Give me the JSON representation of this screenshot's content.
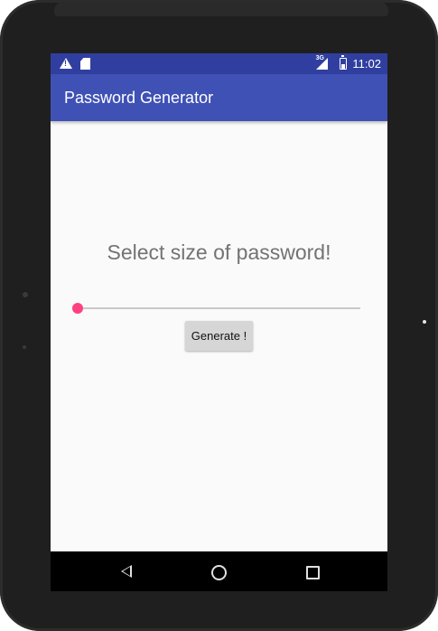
{
  "status_bar": {
    "icons": [
      "warning-icon",
      "sd-card-icon",
      "network-3g-icon",
      "signal-icon",
      "battery-charging-icon"
    ],
    "network_label": "3G",
    "time": "11:02"
  },
  "app_bar": {
    "title": "Password Generator",
    "color": "#3f51b5",
    "status_color": "#303f9f"
  },
  "main": {
    "prompt": "Select size of password!",
    "slider": {
      "value": 0,
      "accent": "#ff4081"
    },
    "generate_label": "Generate !"
  },
  "nav_bar": {
    "icons": [
      "back-icon",
      "home-icon",
      "recents-icon"
    ]
  }
}
